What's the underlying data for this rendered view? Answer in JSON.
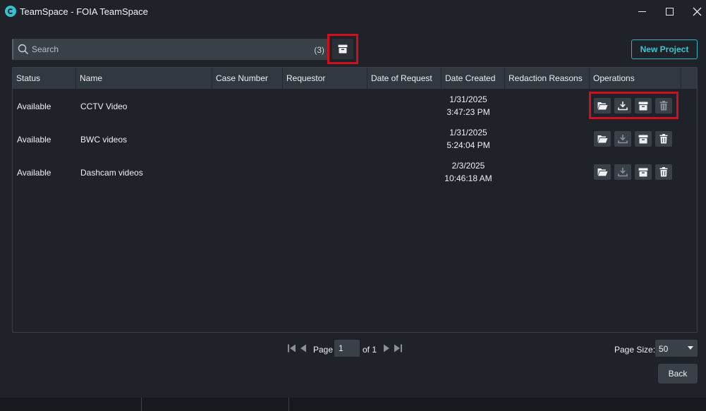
{
  "window": {
    "title": "TeamSpace - FOIA TeamSpace"
  },
  "toolbar": {
    "search_placeholder": "Search",
    "result_count": "(3)",
    "new_project_label": "New Project"
  },
  "table": {
    "columns": [
      "Status",
      "Name",
      "Case Number",
      "Requestor",
      "Date of Request",
      "Date Created",
      "Redaction Reasons",
      "Operations"
    ],
    "rows": [
      {
        "status": "Available",
        "name": "CCTV Video",
        "case_number": "",
        "requestor": "",
        "date_of_request": "",
        "date_created_date": "1/31/2025",
        "date_created_time": "3:47:23 PM",
        "redaction_reasons": ""
      },
      {
        "status": "Available",
        "name": "BWC videos",
        "case_number": "",
        "requestor": "",
        "date_of_request": "",
        "date_created_date": "1/31/2025",
        "date_created_time": "5:24:04 PM",
        "redaction_reasons": ""
      },
      {
        "status": "Available",
        "name": "Dashcam videos",
        "case_number": "",
        "requestor": "",
        "date_of_request": "",
        "date_created_date": "2/3/2025",
        "date_created_time": "10:46:18 AM",
        "redaction_reasons": ""
      }
    ],
    "operation_icons": [
      "open-folder-icon",
      "download-icon",
      "archive-icon",
      "trash-icon"
    ]
  },
  "pagination": {
    "page_label": "Page",
    "current_page": "1",
    "of_label": "of 1",
    "page_size_label": "Page Size:",
    "page_size_value": "50"
  },
  "footer": {
    "back_label": "Back"
  },
  "colors": {
    "background": "#1f2329",
    "accent": "#33c4cf",
    "highlight": "#d0101c"
  }
}
